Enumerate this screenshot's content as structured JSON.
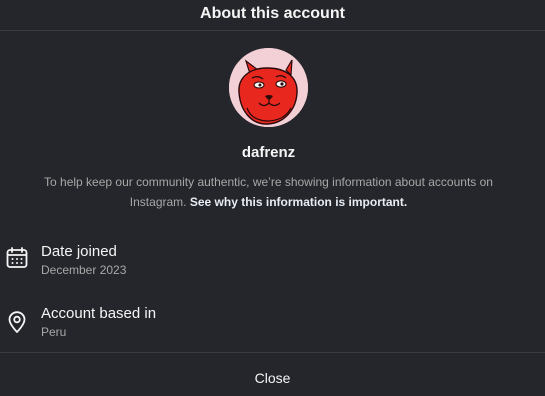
{
  "dialog": {
    "title": "About this account"
  },
  "profile": {
    "username": "dafrenz",
    "avatar_icon": "devil-cartoon-avatar",
    "avatar_bg": "#f3cfd6",
    "avatar_color": "#e8281f"
  },
  "info": {
    "text": "To help keep our community authentic, we’re showing information about accounts on Instagram.",
    "link": "See why this information is important."
  },
  "details": {
    "date_joined": {
      "icon": "calendar-icon",
      "label": "Date joined",
      "value": "December 2023"
    },
    "account_based_in": {
      "icon": "location-pin-icon",
      "label": "Account based in",
      "value": "Peru"
    }
  },
  "footer": {
    "close_label": "Close"
  },
  "colors": {
    "background": "#25262b",
    "divider": "#3a3b40",
    "primary_text": "#f5f5f5",
    "secondary_text": "#a8a8a8"
  }
}
